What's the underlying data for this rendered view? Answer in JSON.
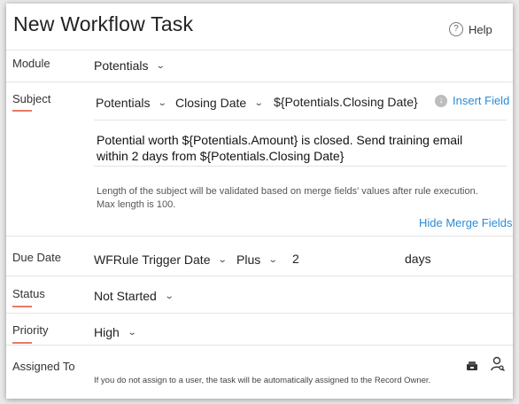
{
  "dialog": {
    "title": "New Workflow Task",
    "help_label": "Help",
    "help_icon_glyph": "?"
  },
  "module": {
    "label": "Module",
    "value": "Potentials"
  },
  "subject": {
    "label": "Subject",
    "module_select": "Potentials",
    "field_select": "Closing Date",
    "merge_token": "${Potentials.Closing Date}",
    "insert_field_label": "Insert Field",
    "text_line1": "Potential worth ${Potentials.Amount} is closed. Send training email",
    "text_line2": "within 2 days from ${Potentials.Closing Date}",
    "hint_line1": "Length of the subject will be validated based on merge fields' values after rule execution.",
    "hint_line2": "Max length is 100.",
    "hide_merge_fields_label": "Hide Merge Fields"
  },
  "due_date": {
    "label": "Due Date",
    "base_select": "WFRule Trigger Date",
    "operator_select": "Plus",
    "amount": "2",
    "unit": "days"
  },
  "status": {
    "label": "Status",
    "value": "Not Started"
  },
  "priority": {
    "label": "Priority",
    "value": "High"
  },
  "assigned_to": {
    "label": "Assigned To",
    "note": "If you do not assign to a user, the task will be automatically assigned to the Record Owner."
  },
  "colors": {
    "accent_underline": "#e87a68",
    "link": "#2a8bd8"
  },
  "icons": {
    "help": "help-circle-icon",
    "insert": "arrow-down-circle-icon",
    "chevron": "chevron-down-icon",
    "assign_role": "role-assign-icon",
    "user_search": "user-search-icon"
  }
}
